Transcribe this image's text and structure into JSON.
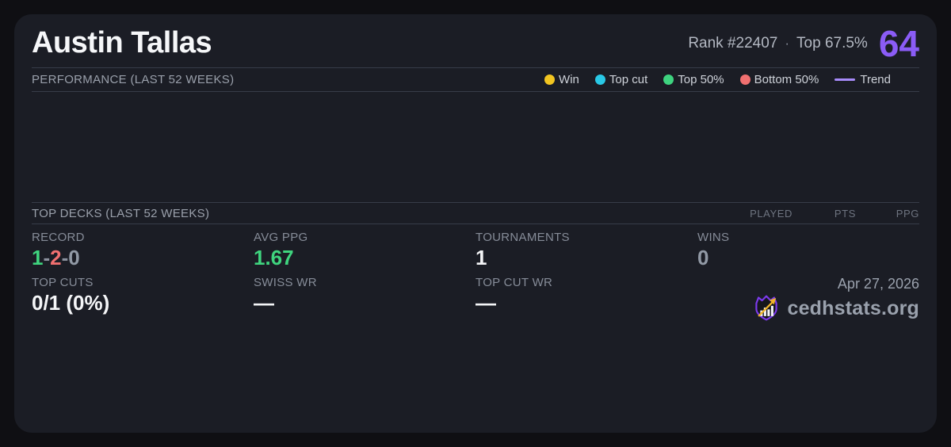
{
  "player": {
    "name": "Austin Tallas",
    "rank": "Rank #22407",
    "separator": "·",
    "top_percent": "Top 67.5%",
    "score": "64"
  },
  "performance": {
    "title": "PERFORMANCE (LAST 52 WEEKS)",
    "legend": [
      {
        "label": "Win",
        "marker": "dot",
        "color": "#f2c521"
      },
      {
        "label": "Top cut",
        "marker": "dot",
        "color": "#29c8e6"
      },
      {
        "label": "Top 50%",
        "marker": "dot",
        "color": "#3ed37f"
      },
      {
        "label": "Bottom 50%",
        "marker": "dot",
        "color": "#f17070"
      },
      {
        "label": "Trend",
        "marker": "line",
        "color": "#a78bfa"
      }
    ],
    "chart": {
      "type": "scatter",
      "points": [],
      "empty": true
    }
  },
  "top_decks": {
    "title": "TOP DECKS (LAST 52 WEEKS)",
    "columns": [
      "PLAYED",
      "PTS",
      "PPG"
    ],
    "rows": []
  },
  "stats": {
    "record": {
      "label": "RECORD",
      "wins": "1",
      "losses": "2",
      "draws": "0",
      "separator": "-"
    },
    "avg_ppg": {
      "label": "AVG PPG",
      "value": "1.67"
    },
    "tournaments": {
      "label": "TOURNAMENTS",
      "value": "1"
    },
    "wins": {
      "label": "WINS",
      "value": "0"
    },
    "top_cuts": {
      "label": "TOP CUTS",
      "value": "0/1 (0%)"
    },
    "swiss_wr": {
      "label": "SWISS WR",
      "value": "—"
    },
    "top_cut_wr": {
      "label": "TOP CUT WR",
      "value": "—"
    }
  },
  "footer": {
    "date": "Apr 27, 2026",
    "site": "cedhstats.org"
  },
  "colors": {
    "page_bg": "#0f0f13",
    "card_bg": "#1b1d25",
    "rule": "#373c49",
    "accent_purple": "#8b5cf6",
    "win_green": "#3fd47e",
    "loss_red": "#f17070",
    "neutral_gray": "#9199a5",
    "label_gray": "#868c98",
    "text_white": "#f4f5f7",
    "logo_purple": "#7c3aed",
    "logo_gold": "#f0b429"
  }
}
